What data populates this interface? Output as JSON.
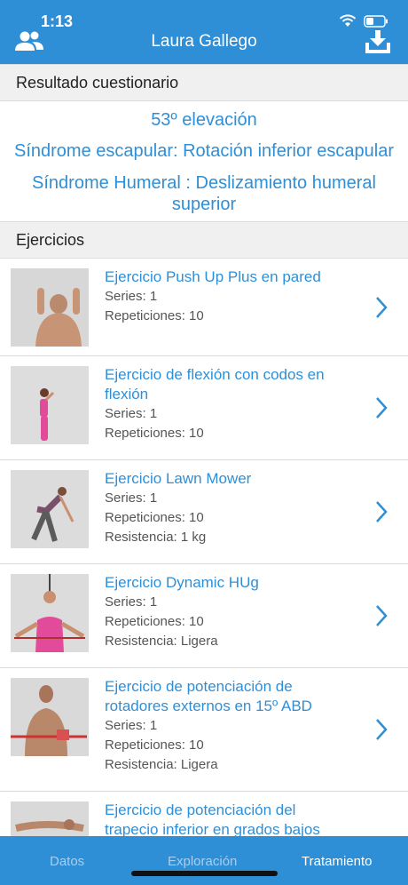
{
  "status_bar": {
    "time": "1:13"
  },
  "header": {
    "title": "Laura Gallego",
    "left_icon": "users-icon",
    "right_icon": "download-icon",
    "color": "#2f8fd6"
  },
  "result_section": {
    "header": "Resultado cuestionario",
    "elevation": "53º elevación",
    "scapular": "Síndrome escapular: Rotación inferior escapular",
    "humeral": "Síndrome Humeral : Deslizamiento humeral superior"
  },
  "exercises_section": {
    "header": "Ejercicios",
    "items": [
      {
        "title": "Ejercicio Push Up Plus en pared",
        "series": "Series: 1",
        "reps": "Repeticiones: 10",
        "resistance": ""
      },
      {
        "title": "Ejercicio de flexión con codos en flexión",
        "series": "Series: 1",
        "reps": "Repeticiones: 10",
        "resistance": ""
      },
      {
        "title": "Ejercicio Lawn Mower",
        "series": "Series: 1",
        "reps": "Repeticiones: 10",
        "resistance": "Resistencia: 1 kg"
      },
      {
        "title": "Ejercicio Dynamic HUg",
        "series": "Series: 1",
        "reps": "Repeticiones: 10",
        "resistance": "Resistencia: Ligera"
      },
      {
        "title": "Ejercicio de potenciación de rotadores externos en 15º ABD",
        "series": "Series: 1",
        "reps": "Repeticiones: 10",
        "resistance": "Resistencia: Ligera"
      },
      {
        "title": "Ejercicio de potenciación del trapecio inferior en grados bajos",
        "series": "",
        "reps": "",
        "resistance": ""
      }
    ]
  },
  "tabbar": {
    "tabs": [
      {
        "label": "Datos",
        "active": false
      },
      {
        "label": "Exploración",
        "active": false
      },
      {
        "label": "Tratamiento",
        "active": true
      }
    ]
  }
}
